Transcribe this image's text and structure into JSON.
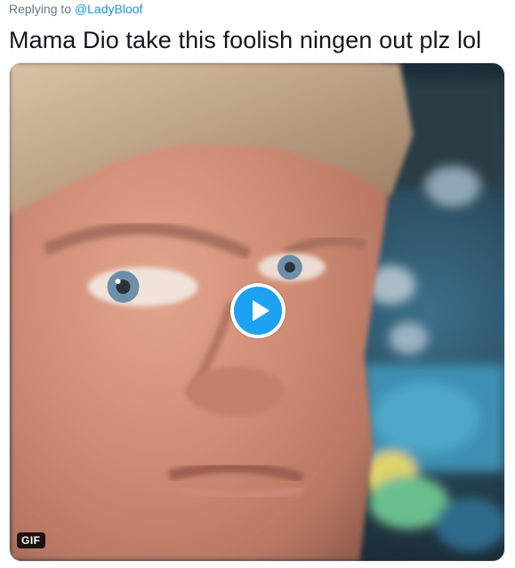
{
  "reply": {
    "prefix": "Replying to ",
    "handle": "@LadyBloof"
  },
  "tweet": {
    "text": "Mama Dio take this foolish ningen out plz lol"
  },
  "media": {
    "badge": "GIF",
    "play_icon": "play-icon",
    "accent": "#1da1f2"
  },
  "colors": {
    "muted_text": "#657786",
    "link": "#1b95e0",
    "body_text": "#14171a"
  }
}
